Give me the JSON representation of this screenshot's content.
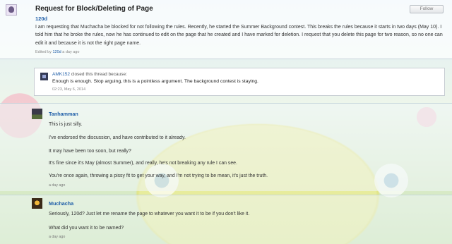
{
  "thread": {
    "title": "Request for Block/Deleting of Page",
    "follow_label": "Follow",
    "author": "120d",
    "body": "I am requesting that Muchacha be blocked for not following the rules. Recently, he started the Summer Background contest. This breaks the rules because it starts in two days (May 10). I told him that he broke the rules, now he has continued to edit on the page that he created and I have marked for deletion. I request that you delete this page for two reason, so no one can edit it and because it is not the right page name.",
    "edited_prefix": "Edited by",
    "edited_author": "120d",
    "edited_time": "a day ago"
  },
  "closure": {
    "user": "AMK152",
    "action": "closed this thread because:",
    "reason": "Enough is enough. Stop arguing, this is a pointless argument. The background contest is staying.",
    "timestamp": "02:23, May 6, 2014"
  },
  "replies": [
    {
      "author": "Tanhamman",
      "lines": [
        "This is just silly.",
        "I've endorsed the discussion, and have contributed to it already.",
        "It may have been too soon, but really?",
        "It's fine since it's May (almost Summer), and really, he's not breaking any rule I can see.",
        "You're once again, throwing a pissy fit to get your way, and I'm not trying to be mean, it's just the truth."
      ],
      "time": "a day ago"
    },
    {
      "author": "Muchacha",
      "lines": [
        "Seriously, 120d? Just let me rename the page to whatever you want it to be if you don't like it.",
        "What did you want it to be named?"
      ],
      "time": "a day ago"
    }
  ],
  "colors": {
    "link": "#1f5ea8",
    "title": "#222222",
    "background_top": "#dfeef6",
    "background_bottom": "#c9e3b0"
  },
  "icons": {
    "main_avatar": "avatar-120d",
    "closer_avatar": "avatar-amk152",
    "reply_avatars": [
      "avatar-tanhamman",
      "avatar-muchacha"
    ]
  }
}
